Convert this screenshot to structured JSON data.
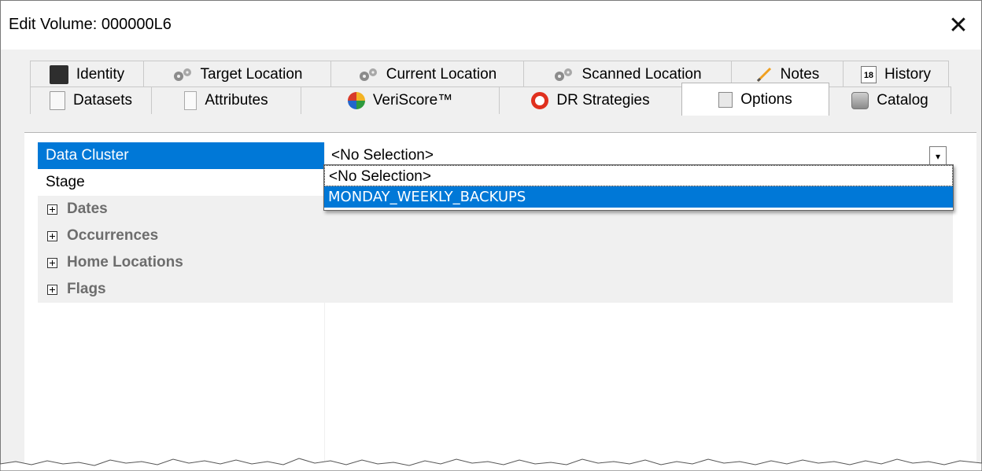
{
  "window": {
    "title": "Edit Volume: 000000L6",
    "close_glyph": "✕"
  },
  "tabs": {
    "row1": [
      {
        "label": "Identity",
        "icon": "identity-icon"
      },
      {
        "label": "Target Location",
        "icon": "cogs-icon"
      },
      {
        "label": "Current Location",
        "icon": "cogs-icon"
      },
      {
        "label": "Scanned Location",
        "icon": "cogs-icon"
      },
      {
        "label": "Notes",
        "icon": "pencil-icon"
      },
      {
        "label": "History",
        "icon": "calendar-icon",
        "icon_text": "18"
      }
    ],
    "row2": [
      {
        "label": "Datasets",
        "icon": "document-icon"
      },
      {
        "label": "Attributes",
        "icon": "attributes-icon"
      },
      {
        "label": "VeriScore™",
        "icon": "veriscore-icon"
      },
      {
        "label": "DR Strategies",
        "icon": "lifebuoy-icon"
      },
      {
        "label": "Options",
        "icon": "options-icon",
        "active": true
      },
      {
        "label": "Catalog",
        "icon": "catalog-icon"
      }
    ]
  },
  "properties": {
    "data_cluster": {
      "label": "Data Cluster",
      "value": "<No Selection>"
    },
    "stage": {
      "label": "Stage",
      "value": ""
    },
    "categories": [
      "Dates",
      "Occurrences",
      "Home Locations",
      "Flags"
    ]
  },
  "dropdown": {
    "options": [
      "<No Selection>",
      "MONDAY_WEEKLY_BACKUPS"
    ],
    "highlighted_index": 1
  },
  "colors": {
    "selection": "#0078d7",
    "category_text": "#6d6d6d",
    "panel_bg": "#f0f0f0"
  }
}
